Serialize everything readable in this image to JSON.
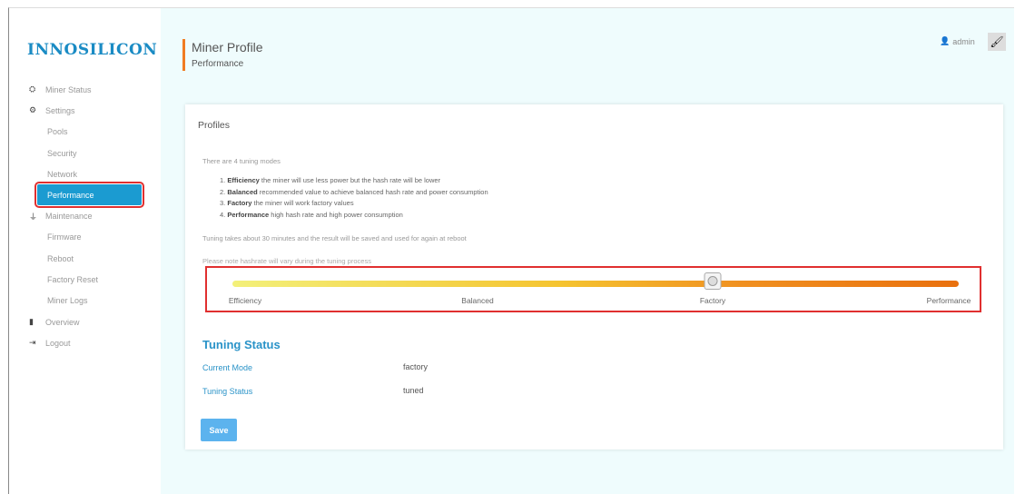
{
  "brand": "INNOSILICON",
  "sidebar": {
    "items": [
      {
        "label": "Miner Status",
        "icon": "dashboard-icon",
        "glyph": "⛭"
      },
      {
        "label": "Settings",
        "icon": "cogs-icon",
        "glyph": "⚙"
      },
      {
        "label": "Pools"
      },
      {
        "label": "Security"
      },
      {
        "label": "Network"
      },
      {
        "label": "Performance"
      },
      {
        "label": "Maintenance",
        "icon": "plug-icon",
        "glyph": "⏚"
      },
      {
        "label": "Firmware"
      },
      {
        "label": "Reboot"
      },
      {
        "label": "Factory Reset"
      },
      {
        "label": "Miner Logs"
      },
      {
        "label": "Overview",
        "icon": "book-icon",
        "glyph": "▮"
      },
      {
        "label": "Logout",
        "icon": "logout-icon",
        "glyph": "⇥"
      }
    ]
  },
  "header": {
    "title": "Miner Profile",
    "subtitle": "Performance",
    "user": "admin",
    "user_icon": "👤",
    "theme_icon": "🖌"
  },
  "card": {
    "title": "Profiles",
    "intro": "There are 4 tuning modes",
    "modes": [
      {
        "num": "1.",
        "name": "Efficiency",
        "desc": " the miner will use less power but the hash rate will be lower"
      },
      {
        "num": "2.",
        "name": "Balanced",
        "desc": " recommended value to achieve balanced hash rate and power consumption"
      },
      {
        "num": "3.",
        "name": "Factory",
        "desc": " the miner will work factory values"
      },
      {
        "num": "4.",
        "name": "Performance",
        "desc": " high hash rate and high power consumption"
      }
    ],
    "note1": "Tuning takes about 30 minutes and the result will be saved and used for again at reboot",
    "note2": "Please note hashrate will vary during the tuning process",
    "slider": {
      "labels": [
        "Efficiency",
        "Balanced",
        "Factory",
        "Performance"
      ],
      "selected_index": 2
    },
    "status": {
      "title": "Tuning Status",
      "current_mode_label": "Current Mode",
      "current_mode": "factory",
      "tuning_status_label": "Tuning Status",
      "tuning_status": "tuned"
    },
    "save_label": "Save"
  },
  "colors": {
    "accent": "#1b9bd1",
    "header_bar": "#f07c22",
    "highlight": "#e03030"
  }
}
